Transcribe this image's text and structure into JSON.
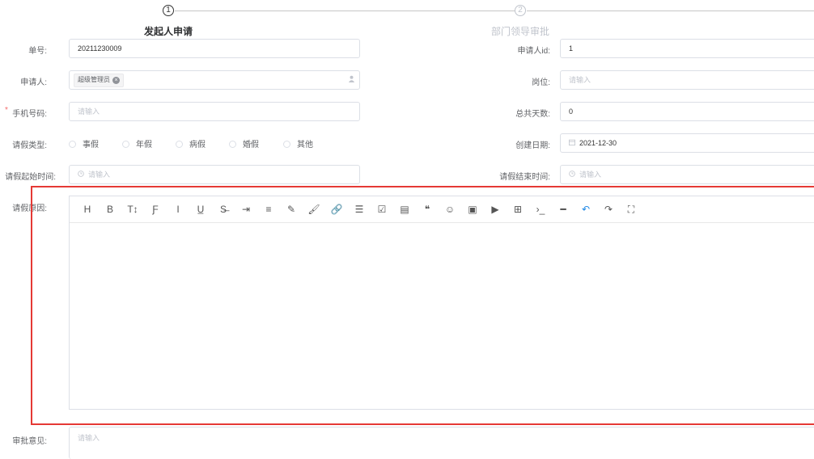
{
  "steps": [
    {
      "number": "1",
      "title": "发起人申请",
      "active": true
    },
    {
      "number": "2",
      "title": "部门领导审批",
      "active": false
    }
  ],
  "form": {
    "order_no": {
      "label": "单号:",
      "value": "20211230009"
    },
    "applicant_id": {
      "label": "申请人id:",
      "value": "1"
    },
    "applicant": {
      "label": "申请人:",
      "tag": "超级管理员",
      "icon": "user-icon"
    },
    "position": {
      "label": "岗位:",
      "placeholder": "请输入"
    },
    "phone": {
      "label": "手机号码:",
      "placeholder": "请输入",
      "required_mark": "*"
    },
    "total_days": {
      "label": "总共天数:",
      "value": "0"
    },
    "leave_type": {
      "label": "请假类型:",
      "options": [
        "事假",
        "年假",
        "病假",
        "婚假",
        "其他"
      ]
    },
    "created_date": {
      "label": "创建日期:",
      "value": "2021-12-30",
      "icon": "calendar-icon"
    },
    "start_time": {
      "label": "请假起始时间:",
      "placeholder": "请输入",
      "icon": "clock-icon"
    },
    "end_time": {
      "label": "请假结束时间:",
      "placeholder": "请输入",
      "icon": "clock-icon"
    },
    "reason": {
      "label": "请假原因:"
    },
    "approval_opinion": {
      "label": "审批意见:",
      "placeholder": "请输入"
    }
  },
  "editor_toolbar": [
    {
      "name": "heading-icon",
      "glyph": "H"
    },
    {
      "name": "bold-icon",
      "glyph": "B"
    },
    {
      "name": "font-size-icon",
      "glyph": "T↕"
    },
    {
      "name": "font-family-icon",
      "glyph": "Ƒ"
    },
    {
      "name": "italic-icon",
      "glyph": "I"
    },
    {
      "name": "underline-icon",
      "glyph": "U̲"
    },
    {
      "name": "strikethrough-icon",
      "glyph": "S̶"
    },
    {
      "name": "indent-icon",
      "glyph": "⇥"
    },
    {
      "name": "line-height-icon",
      "glyph": "≡"
    },
    {
      "name": "font-color-icon",
      "glyph": "✎"
    },
    {
      "name": "background-color-icon",
      "glyph": "🖌"
    },
    {
      "name": "link-icon",
      "glyph": "🔗"
    },
    {
      "name": "list-icon",
      "glyph": "☰"
    },
    {
      "name": "todo-icon",
      "glyph": "☑"
    },
    {
      "name": "justify-icon",
      "glyph": "▤"
    },
    {
      "name": "quote-icon",
      "glyph": "❝"
    },
    {
      "name": "emoji-icon",
      "glyph": "☺"
    },
    {
      "name": "image-icon",
      "glyph": "▣"
    },
    {
      "name": "video-icon",
      "glyph": "▶"
    },
    {
      "name": "table-icon",
      "glyph": "⊞"
    },
    {
      "name": "code-icon",
      "glyph": "›_"
    },
    {
      "name": "divider-icon",
      "glyph": "━"
    },
    {
      "name": "undo-icon",
      "glyph": "↶"
    },
    {
      "name": "redo-icon",
      "glyph": "↷"
    },
    {
      "name": "fullscreen-icon",
      "glyph": "⛶"
    }
  ],
  "colors": {
    "highlight": "#e53935",
    "undo_accent": "#1e88e5",
    "required": "#f56c6c"
  }
}
